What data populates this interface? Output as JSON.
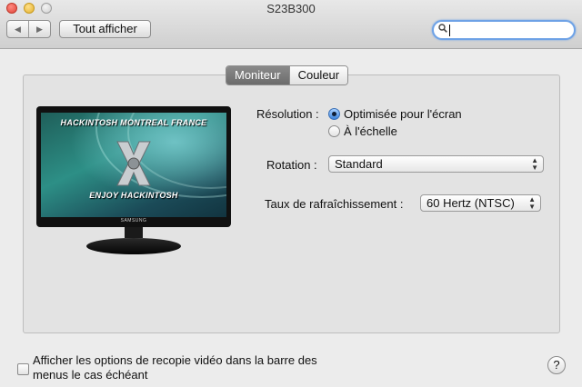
{
  "window": {
    "title": "S23B300"
  },
  "toolbar": {
    "back_icon": "◀",
    "forward_icon": "▶",
    "show_all_label": "Tout afficher",
    "search_value": "",
    "search_icon": "🔍"
  },
  "tabs": [
    {
      "label": "Moniteur",
      "active": true
    },
    {
      "label": "Couleur",
      "active": false
    }
  ],
  "monitor_image": {
    "top_text": "HACKINTOSH MONTREAL FRANCE",
    "bottom_text": "ENJOY HACKINTOSH",
    "brand": "SAMSUNG"
  },
  "resolution": {
    "label": "Résolution :",
    "options": [
      {
        "label": "Optimisée pour l'écran",
        "selected": true
      },
      {
        "label": "À l'échelle",
        "selected": false
      }
    ]
  },
  "rotation": {
    "label": "Rotation :",
    "value": "Standard"
  },
  "refresh": {
    "label": "Taux de rafraîchissement :",
    "value": "60 Hertz (NTSC)"
  },
  "mirroring_option": {
    "label": "Afficher les options de recopie vidéo dans la barre des menus le cas échéant",
    "checked": false
  },
  "help": {
    "label": "?"
  },
  "colors": {
    "accent": "#3b83dc",
    "search_focus": "#6ea2e6",
    "active_tab": "#7a7a7a"
  }
}
